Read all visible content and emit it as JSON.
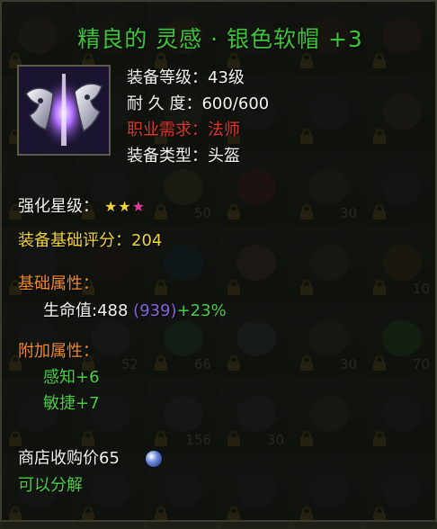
{
  "item": {
    "title": "精良的 灵感 · 银色软帽 +3",
    "icon": "silver-soft-hat-icon",
    "stats": {
      "level_label": "装备等级：",
      "level_value": "43级",
      "durability_label": "耐 久 度：",
      "durability_value": "600/600",
      "class_label": "职业需求：",
      "class_value": "法师",
      "type_label": "装备类型：",
      "type_value": "头盔"
    },
    "enhance_label": "强化星级：",
    "enhance_stars": [
      "★",
      "★",
      "★"
    ],
    "score_label": "装备基础评分：",
    "score_value": "204",
    "base_attr_header": "基础属性：",
    "base_attr": {
      "name": "生命值:",
      "value": "488",
      "total": "(939)",
      "bonus": "+23%"
    },
    "extra_attr_header": "附加属性：",
    "extra_attrs": [
      {
        "name": "感知",
        "value": "+6"
      },
      {
        "name": "敏捷",
        "value": "+7"
      }
    ],
    "shop_price_label": "商店收购价",
    "shop_price_value": "65",
    "currency_icon": "coin-icon",
    "decompose_text": "可以分解"
  },
  "background_slots": [
    {
      "num": "",
      "color": "#5a4a3a"
    },
    {
      "num": "",
      "color": "#4a3a2a"
    },
    {
      "num": "",
      "color": "#6a4a2a"
    },
    {
      "num": "",
      "color": "#3a3a3a"
    },
    {
      "num": "",
      "color": "#5a3a2a"
    },
    {
      "num": "",
      "color": "#6a3a2a"
    },
    {
      "num": "",
      "color": "#3a3a3a"
    },
    {
      "num": "",
      "color": "#3a3a3a"
    },
    {
      "num": "",
      "color": "#4a4a3a"
    },
    {
      "num": "",
      "color": "#3a3a3a"
    },
    {
      "num": "",
      "color": "#3a3a3a"
    },
    {
      "num": "",
      "color": "#5a4a3a"
    },
    {
      "num": "",
      "color": "#3a3a3a"
    },
    {
      "num": "",
      "color": "#3a3a3a"
    },
    {
      "num": "50",
      "color": "#6a5a3a"
    },
    {
      "num": "",
      "color": "#7a2a2a"
    },
    {
      "num": "30",
      "color": "#4a4a3a"
    },
    {
      "num": "",
      "color": "#3a3a3a"
    },
    {
      "num": "",
      "color": "#3a3a3a"
    },
    {
      "num": "",
      "color": "#4a2a2a"
    },
    {
      "num": "",
      "color": "#2a4a6a"
    },
    {
      "num": "",
      "color": "#6a4a4a"
    },
    {
      "num": "",
      "color": "#4a4a3a"
    },
    {
      "num": "10",
      "color": "#6a4a2a"
    },
    {
      "num": "",
      "color": "#3a3a3a"
    },
    {
      "num": "52",
      "color": "#4a4a4a"
    },
    {
      "num": "66",
      "color": "#3a6a3a"
    },
    {
      "num": "",
      "color": "#4a5a6a"
    },
    {
      "num": "30",
      "color": "#4a4a3a"
    },
    {
      "num": "70",
      "color": "#3a7a3a"
    },
    {
      "num": "",
      "color": "#3a3a3a"
    },
    {
      "num": "",
      "color": "#3a3a3a"
    },
    {
      "num": "156",
      "color": "#4a4a4a"
    },
    {
      "num": "30",
      "color": "#4a4a4a"
    },
    {
      "num": "",
      "color": "#4a4a3a"
    },
    {
      "num": "",
      "color": "#3a3a3a"
    },
    {
      "num": "",
      "color": "#3a3a3a"
    },
    {
      "num": "",
      "color": "#3a3a3a"
    },
    {
      "num": "",
      "color": "#3a3a3a"
    },
    {
      "num": "",
      "color": "#3a3a3a"
    },
    {
      "num": "",
      "color": "#3a3a3a"
    },
    {
      "num": "",
      "color": "#3a3a3a"
    }
  ]
}
